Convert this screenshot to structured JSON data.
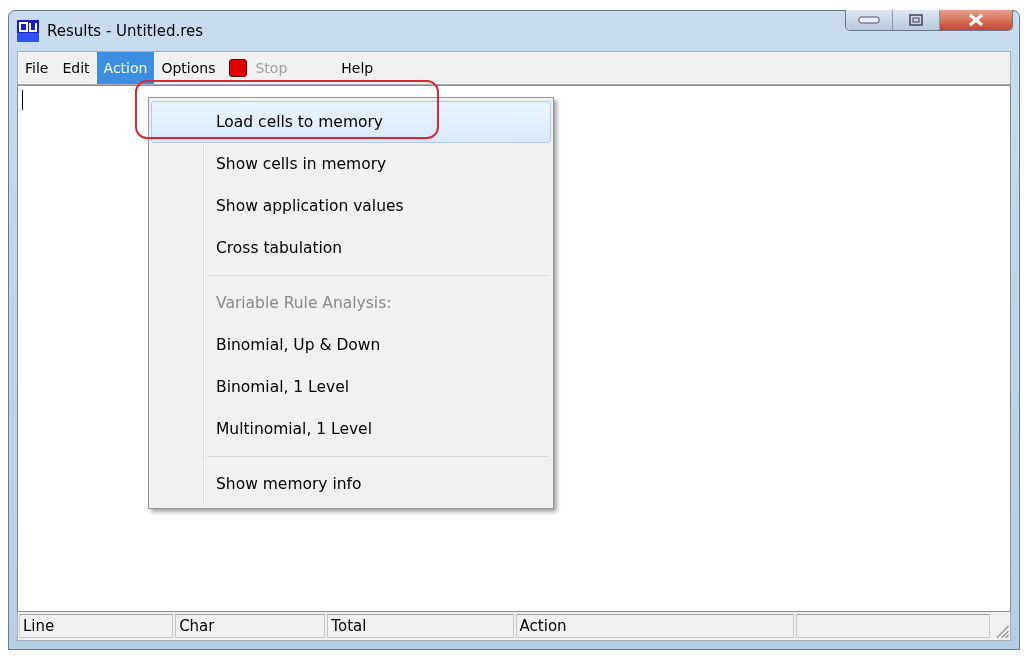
{
  "window": {
    "title": "Results - Untitled.res"
  },
  "menu_bar": [
    {
      "label": "File",
      "selected": false,
      "disabled": false
    },
    {
      "label": "Edit",
      "selected": false,
      "disabled": false
    },
    {
      "label": "Action",
      "selected": true,
      "disabled": false
    },
    {
      "label": "Options",
      "selected": false,
      "disabled": false
    },
    {
      "label": "Stop",
      "selected": false,
      "disabled": true,
      "kind": "stop"
    },
    {
      "label": "Help",
      "selected": false,
      "disabled": false
    }
  ],
  "dropdown": [
    {
      "kind": "item",
      "label": "Load cells to memory",
      "selected": true,
      "disabled": false
    },
    {
      "kind": "item",
      "label": "Show cells in memory",
      "selected": false,
      "disabled": false
    },
    {
      "kind": "item",
      "label": "Show application values",
      "selected": false,
      "disabled": false
    },
    {
      "kind": "item",
      "label": "Cross tabulation",
      "selected": false,
      "disabled": false
    },
    {
      "kind": "separator"
    },
    {
      "kind": "item",
      "label": "Variable Rule Analysis:",
      "selected": false,
      "disabled": true
    },
    {
      "kind": "item",
      "label": "Binomial, Up & Down",
      "selected": false,
      "disabled": false
    },
    {
      "kind": "item",
      "label": "Binomial, 1 Level",
      "selected": false,
      "disabled": false
    },
    {
      "kind": "item",
      "label": "Multinomial, 1 Level",
      "selected": false,
      "disabled": false
    },
    {
      "kind": "separator"
    },
    {
      "kind": "item",
      "label": "Show memory info",
      "selected": false,
      "disabled": false
    }
  ],
  "status_bar": [
    "Line",
    "Char",
    "Total",
    "Action"
  ]
}
